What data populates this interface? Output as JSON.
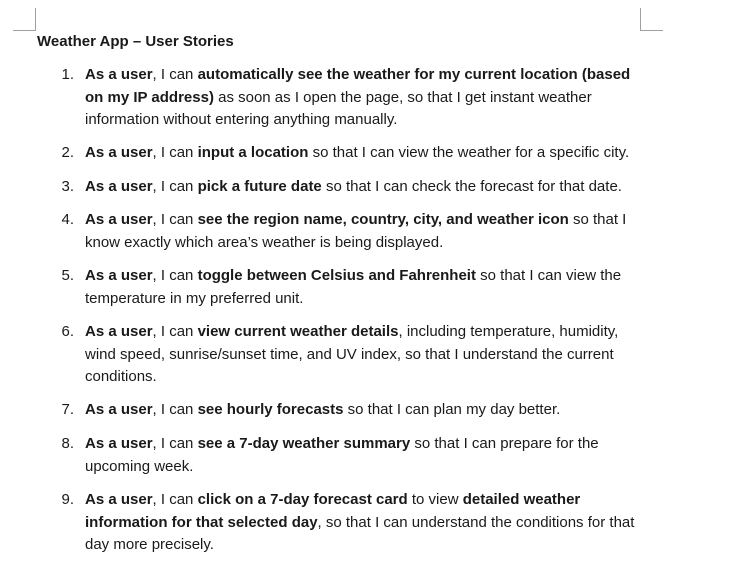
{
  "document": {
    "title": "Weather App – User Stories",
    "stories": [
      {
        "number": "1.",
        "segments": [
          {
            "text": "As a user",
            "bold": true
          },
          {
            "text": ", I can ",
            "bold": false
          },
          {
            "text": "automatically see the weather for my current location (based on my IP address)",
            "bold": true
          },
          {
            "text": " as soon as I open the page, so that I get instant weather information without entering anything manually.",
            "bold": false
          }
        ]
      },
      {
        "number": "2.",
        "segments": [
          {
            "text": "As a user",
            "bold": true
          },
          {
            "text": ", I can ",
            "bold": false
          },
          {
            "text": "input a location",
            "bold": true
          },
          {
            "text": " so that I can view the weather for a specific city.",
            "bold": false
          }
        ]
      },
      {
        "number": "3.",
        "segments": [
          {
            "text": "As a user",
            "bold": true
          },
          {
            "text": ", I can ",
            "bold": false
          },
          {
            "text": "pick a future date",
            "bold": true
          },
          {
            "text": " so that I can check the forecast for that date.",
            "bold": false
          }
        ]
      },
      {
        "number": "4.",
        "segments": [
          {
            "text": "As a user",
            "bold": true
          },
          {
            "text": ", I can ",
            "bold": false
          },
          {
            "text": "see the region name, country, city, and weather icon",
            "bold": true
          },
          {
            "text": " so that I know exactly which area’s weather is being displayed.",
            "bold": false
          }
        ]
      },
      {
        "number": "5.",
        "segments": [
          {
            "text": "As a user",
            "bold": true
          },
          {
            "text": ", I can ",
            "bold": false
          },
          {
            "text": "toggle between Celsius and Fahrenheit",
            "bold": true
          },
          {
            "text": " so that I can view the temperature in my preferred unit.",
            "bold": false
          }
        ]
      },
      {
        "number": "6.",
        "segments": [
          {
            "text": "As a user",
            "bold": true
          },
          {
            "text": ", I can ",
            "bold": false
          },
          {
            "text": "view current weather details",
            "bold": true
          },
          {
            "text": ", including temperature, humidity, wind speed, sunrise/sunset time, and UV index, so that I understand the current conditions.",
            "bold": false
          }
        ]
      },
      {
        "number": "7.",
        "segments": [
          {
            "text": "As a user",
            "bold": true
          },
          {
            "text": ", I can ",
            "bold": false
          },
          {
            "text": "see hourly forecasts",
            "bold": true
          },
          {
            "text": " so that I can plan my day better.",
            "bold": false
          }
        ]
      },
      {
        "number": "8.",
        "segments": [
          {
            "text": "As a user",
            "bold": true
          },
          {
            "text": ", I can ",
            "bold": false
          },
          {
            "text": "see a 7-day weather summary",
            "bold": true
          },
          {
            "text": " so that I can prepare for the upcoming week.",
            "bold": false
          }
        ]
      },
      {
        "number": "9.",
        "segments": [
          {
            "text": "As a user",
            "bold": true
          },
          {
            "text": ", I can ",
            "bold": false
          },
          {
            "text": "click on a 7-day forecast card",
            "bold": true
          },
          {
            "text": " to view ",
            "bold": false
          },
          {
            "text": "detailed weather information for that selected day",
            "bold": true
          },
          {
            "text": ", so that I can understand the conditions for that day more precisely.",
            "bold": false
          }
        ]
      }
    ]
  }
}
